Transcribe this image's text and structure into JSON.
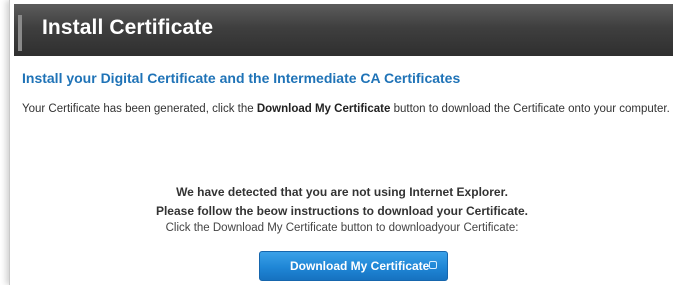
{
  "header": {
    "title": "Install Certificate"
  },
  "content": {
    "subheader": "Install your Digital Certificate and the Intermediate CA Certificates",
    "generated_before": "Your Certificate has been generated, click the ",
    "generated_bold": "Download My Certificate",
    "generated_after": " button to download the Certificate onto your computer.",
    "notice_line1": "We have detected that you are not using Internet Explorer.",
    "notice_line2": "Please follow the beow instructions to download your Certificate.",
    "notice_line3": "Click the Download My Certificate button to downloadyour Certificate:"
  },
  "button": {
    "label": "Download My Certificate",
    "icon": "download-icon"
  }
}
